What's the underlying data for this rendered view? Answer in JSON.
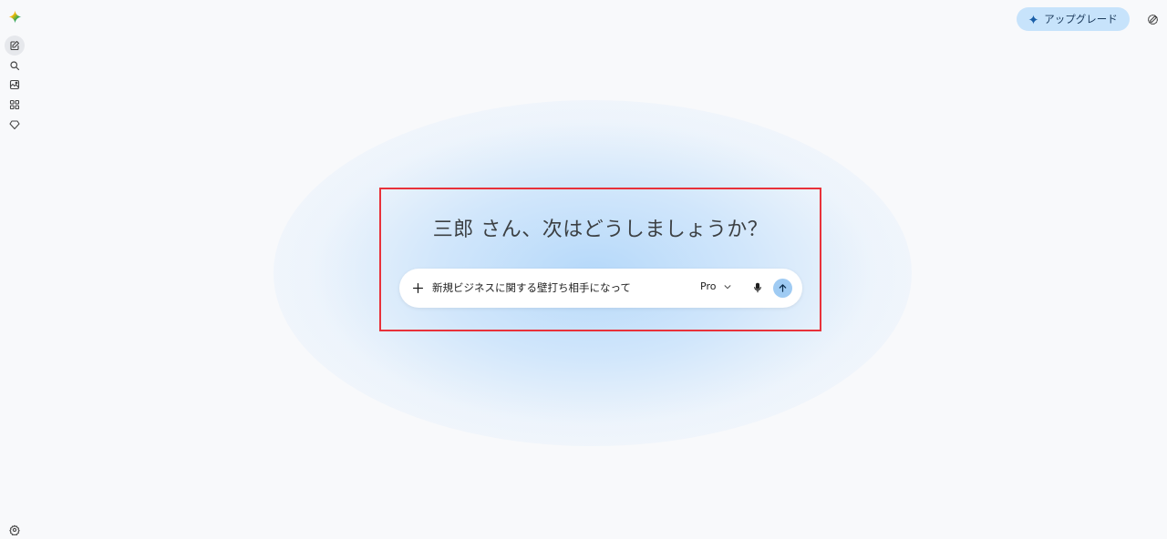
{
  "app": {
    "greeting": "三郎 さん、次はどうしましょうか？"
  },
  "header": {
    "upgrade_label": "アップグレード"
  },
  "prompt": {
    "text": "新規ビジネスに関する壁打ち相手になって",
    "model_label": "Pro"
  },
  "colors": {
    "accent": "#c7e3fb",
    "send": "#9fcbf3",
    "highlight": "#e8313a"
  },
  "icons": {
    "logo": "gemini-spark-icon",
    "sidebar": [
      "new-chat-icon",
      "search-icon",
      "gallery-icon",
      "apps-icon",
      "gem-icon"
    ],
    "settings": "settings-icon"
  }
}
